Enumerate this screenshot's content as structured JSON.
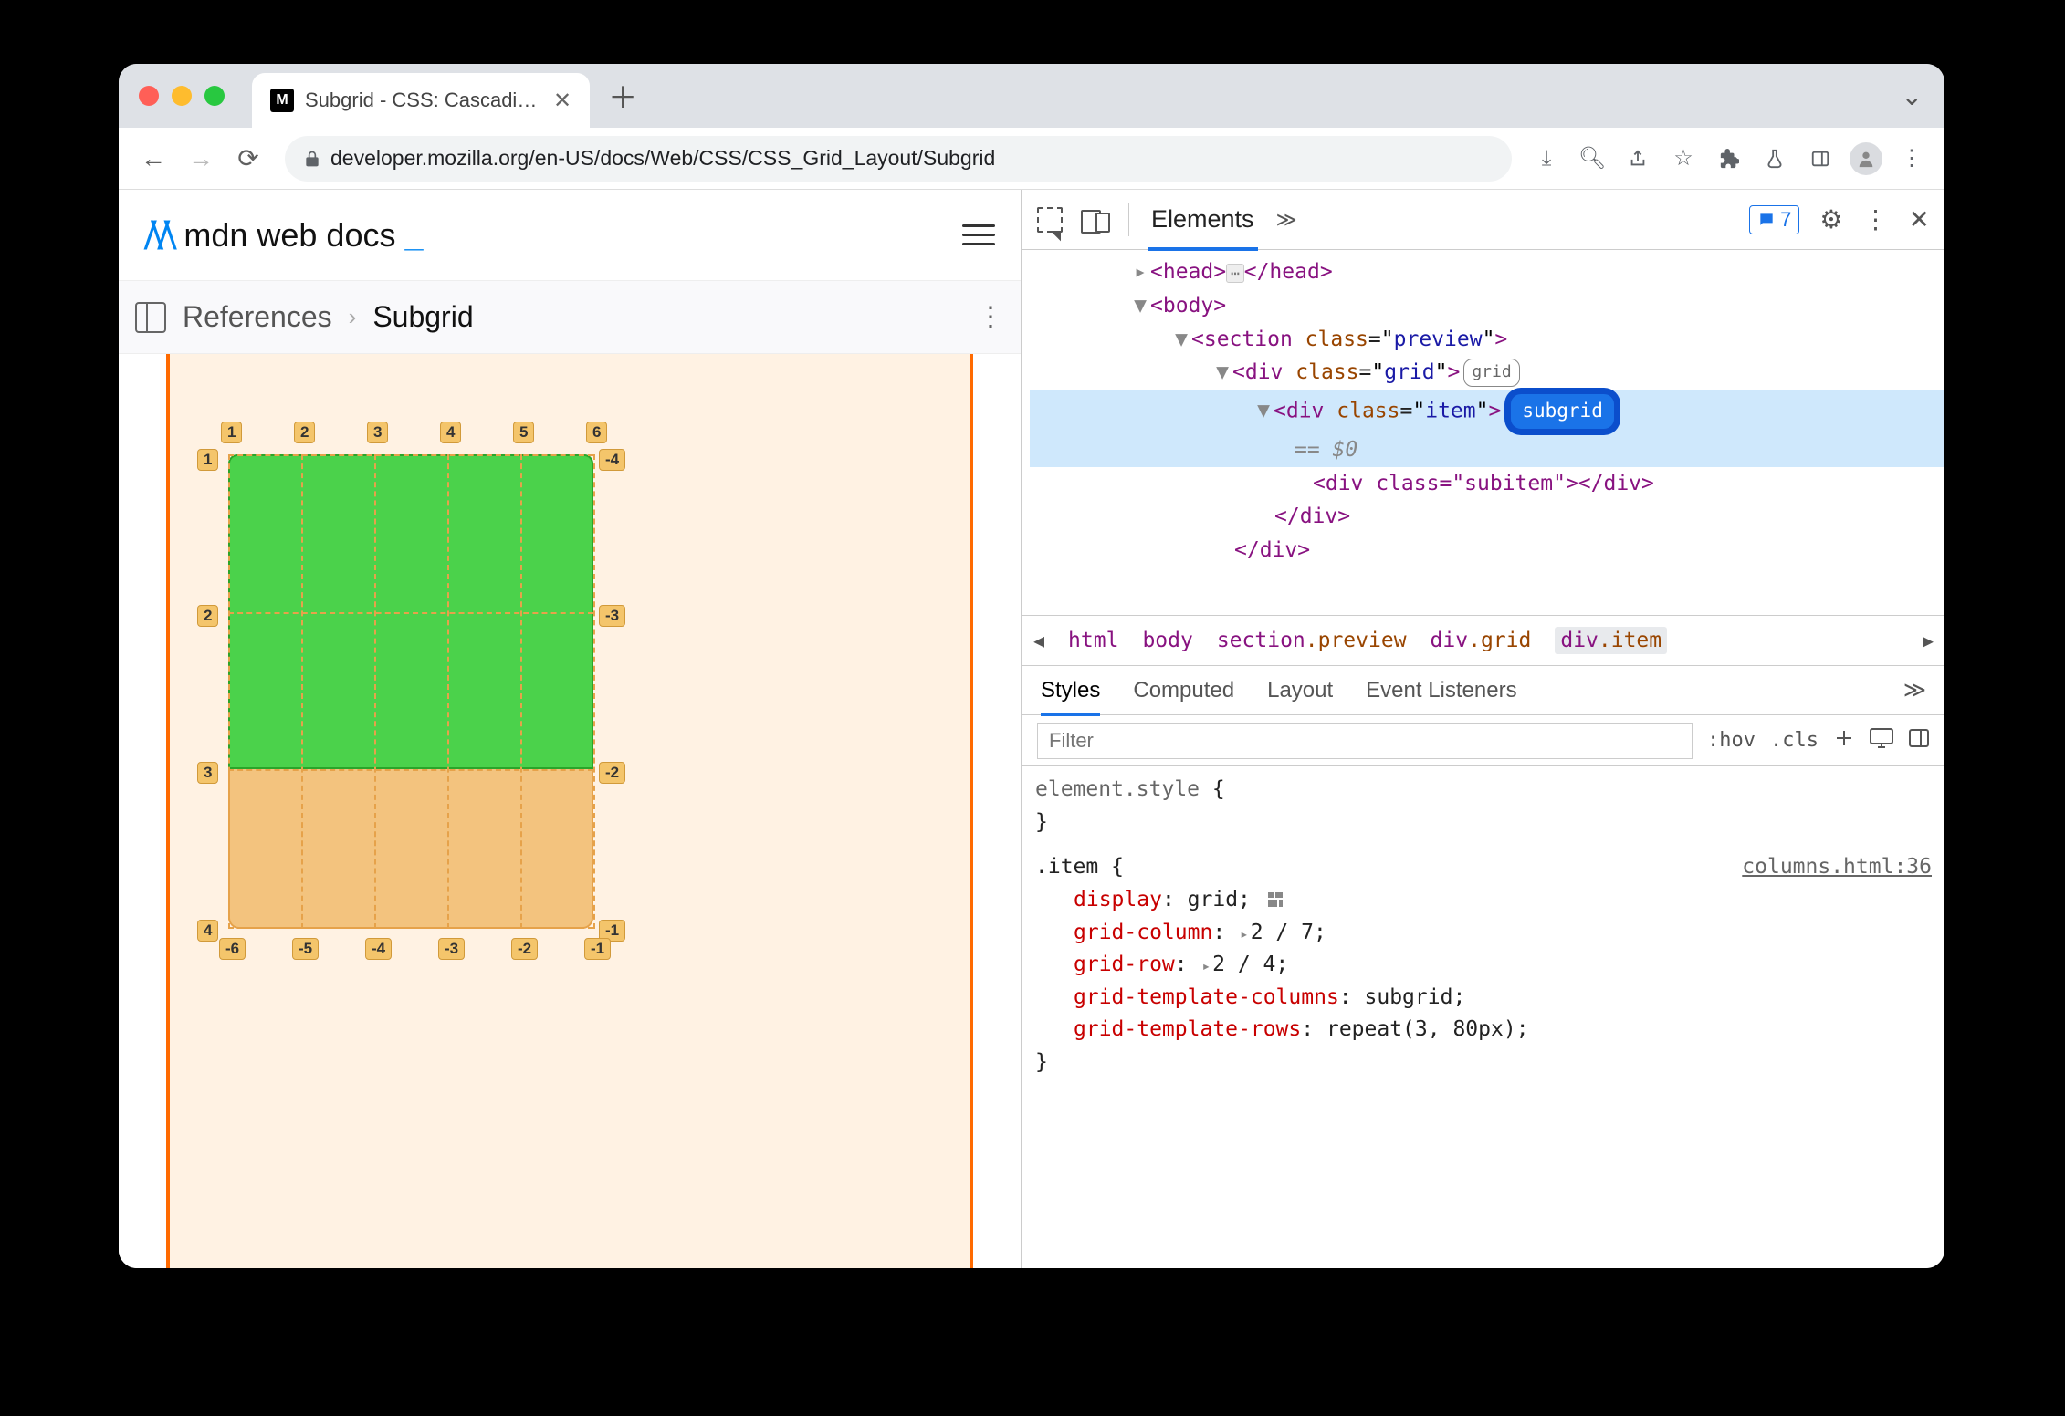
{
  "tab": {
    "title": "Subgrid - CSS: Cascading Style"
  },
  "url": "developer.mozilla.org/en-US/docs/Web/CSS/CSS_Grid_Layout/Subgrid",
  "mdn": {
    "brand_text": "mdn web docs"
  },
  "breadcrumb": {
    "parent": "References",
    "current": "Subgrid"
  },
  "grid_labels": {
    "top": [
      "1",
      "2",
      "3",
      "4",
      "5",
      "6"
    ],
    "left": [
      "1",
      "2",
      "3",
      "4"
    ],
    "right": [
      "-4",
      "-3",
      "-2",
      "-1"
    ],
    "bottom": [
      "-6",
      "-5",
      "-4",
      "-3",
      "-2",
      "-1"
    ]
  },
  "dom": {
    "head_open": "<head>",
    "head_close": "</head>",
    "body_open": "<body>",
    "section_open_t": "section",
    "section_attr_n": "class",
    "section_attr_v": "preview",
    "div_grid_t": "div",
    "div_grid_attr_n": "class",
    "div_grid_attr_v": "grid",
    "div_item_t": "div",
    "div_item_attr_n": "class",
    "div_item_attr_v": "item",
    "eq": "== $0",
    "subitem_line": "<div class=\"subitem\"></div>",
    "div_close": "</div>",
    "grid_badge": "grid",
    "subgrid_badge": "subgrid"
  },
  "devtools": {
    "panel_tab": "Elements",
    "issues_count": "7",
    "crumbs": [
      "html",
      "body",
      "section.preview",
      "div.grid",
      "div.item"
    ],
    "styles_tabs": [
      "Styles",
      "Computed",
      "Layout",
      "Event Listeners"
    ],
    "filter_placeholder": "Filter",
    "hov": ":hov",
    "cls": ".cls"
  },
  "styles": {
    "element_style": "element.style",
    "item_selector": ".item",
    "source": "columns.html:36",
    "props": {
      "display_k": "display",
      "display_v": "grid",
      "gcol_k": "grid-column",
      "gcol_v": "2 / 7",
      "grow_k": "grid-row",
      "grow_v": "2 / 4",
      "gtc_k": "grid-template-columns",
      "gtc_v": "subgrid",
      "gtr_k": "grid-template-rows",
      "gtr_v": "repeat(3, 80px)"
    }
  }
}
